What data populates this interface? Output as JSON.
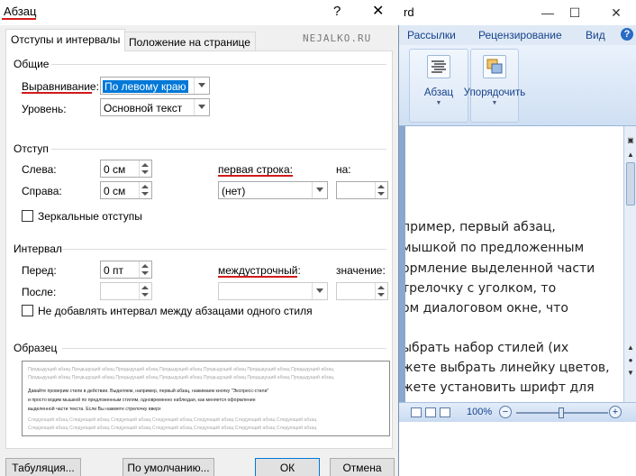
{
  "word": {
    "title": "rd",
    "window_buttons": {
      "minimize": "—",
      "maximize": "☐",
      "close": "✕"
    },
    "ribbon_tabs": [
      "Рассылки",
      "Рецензирование",
      "Вид"
    ],
    "help": "?",
    "groups": [
      {
        "label": "Абзац",
        "icon": "paragraph-icon"
      },
      {
        "label": "Упорядочить",
        "icon": "arrange-icon"
      }
    ],
    "doc_lines": [
      "пример, первый абзац,",
      "мышкой по предложенным",
      "ормление выделенной части",
      "трелочку с уголком, то",
      "ом диалоговом окне, что",
      "",
      "ыбрать набор стилей (их",
      "жете выбрать линейку цветов,",
      "жете установить шрифт для"
    ],
    "zoom_level": "100%",
    "zoom_minus": "−",
    "zoom_plus": "+"
  },
  "dialog": {
    "title": "Абзац",
    "help": "?",
    "close": "✕",
    "watermark": "NEJALKO.RU",
    "tabs": [
      "Отступы и интервалы",
      "Положение на странице"
    ],
    "general": {
      "header": "Общие",
      "alignment_label": "Выравнивание:",
      "alignment_value": "По левому краю",
      "level_label": "Уровень:",
      "level_value": "Основной текст"
    },
    "indent": {
      "header": "Отступ",
      "left_label": "Слева:",
      "left_value": "0 см",
      "right_label": "Справа:",
      "right_value": "0 см",
      "first_line_label": "первая строка:",
      "first_line_value": "(нет)",
      "by_label": "на:",
      "by_value": "",
      "mirror_label": "Зеркальные отступы"
    },
    "spacing": {
      "header": "Интервал",
      "before_label": "Перед:",
      "before_value": "0 пт",
      "after_label": "После:",
      "after_value": "",
      "line_label": "междустрочный:",
      "line_value": "",
      "at_label": "значение:",
      "at_value": "",
      "no_space_label": "Не добавлять интервал между абзацами одного стиля"
    },
    "preview": {
      "header": "Образец",
      "prev_lines": [
        "Предыдущий абзац Предыдущий абзац Предыдущий абзац Предыдущий абзац Предыдущий абзац Предыдущий абзац Предыдущий абзац",
        "Предыдущий абзац Предыдущий абзац Предыдущий абзац Предыдущий абзац Предыдущий абзац Предыдущий абзац Предыдущий абзац"
      ],
      "sample_lines": [
        "Давайте проверим стили в действии. Выделяем, например, первый абзац, нажимаем кнопку \"Экспресс-стили\"",
        "и просто водим мышкой по предложенным стилям, одновременно наблюдая, как меняется оформление",
        "выделенной части текста. Если Вы нажмете стрелочку вверх"
      ],
      "next_lines": [
        "Следующий абзац Следующий абзац Следующий абзац Следующий абзац Следующий абзац Следующий абзац Следующий абзац",
        "Следующий абзац Следующий абзац Следующий абзац Следующий абзац Следующий абзац Следующий абзац Следующий абзац"
      ]
    },
    "buttons": {
      "tabs": "Табуляция...",
      "default": "По умолчанию...",
      "ok": "ОК",
      "cancel": "Отмена"
    }
  }
}
